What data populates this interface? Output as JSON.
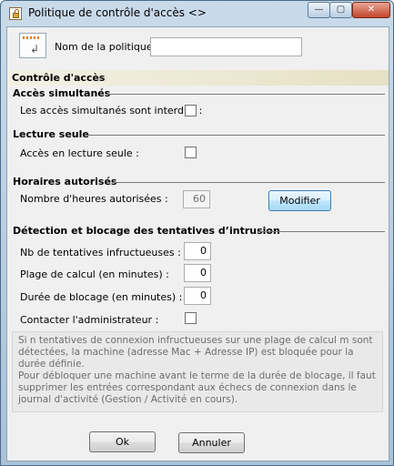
{
  "window": {
    "title": "Politique de contrôle d'accès <>",
    "minimize_glyph": "—",
    "maximize_glyph": "▢",
    "close_glyph": "✕"
  },
  "policy": {
    "name_label": "Nom de la politique :",
    "name_value": ""
  },
  "access_control": {
    "band_title": "Contrôle d'accès",
    "simultaneous": {
      "title": "Accès simultanés",
      "label": "Les accès simultanés sont interdits :",
      "checked": false
    },
    "read_only": {
      "title": "Lecture seule",
      "label": "Accès en lecture seule :",
      "checked": false
    },
    "hours": {
      "title": "Horaires autorisés",
      "label": "Nombre d'heures autorisées :",
      "value": "60",
      "modify_label": "Modifier"
    },
    "intrusion": {
      "title": "Détection et blocage des tentatives d’intrusion",
      "attempts_label": "Nb de tentatives infructueuses :",
      "attempts_value": "0",
      "range_label": "Plage de calcul (en minutes) :",
      "range_value": "0",
      "block_label": "Durée de blocage (en minutes) :",
      "block_value": "0",
      "contact_label": "Contacter l'administrateur :",
      "contact_checked": false
    }
  },
  "info_text": "Si n tentatives de connexion infructueuses sur une plage de calcul m sont détectées, la machine (adresse Mac + Adresse IP) est bloquée pour la durée définie.\nPour débloquer une machine avant le terme de la durée de blocage, il faut supprimer les entrées correspondant aux échecs de connexion dans le journal d'activité (Gestion / Activité en cours).",
  "footer": {
    "ok_label": "Ok",
    "cancel_label": "Annuler"
  },
  "icons": {
    "app": "lock-icon",
    "policy": "policy-document-icon"
  }
}
